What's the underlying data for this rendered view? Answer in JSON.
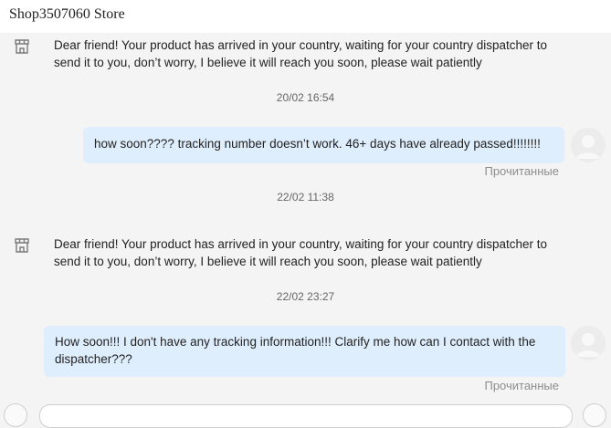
{
  "header": {
    "title": "Shop3507060 Store"
  },
  "messages": [
    {
      "sender": "shop",
      "text": "Dear friend! Your product has arrived in your country, waiting for your country dispatcher to send it to you, don’t worry, I believe it will reach you soon, please wait patiently"
    },
    {
      "timestamp": "20/02 16:54"
    },
    {
      "sender": "user",
      "text": "how soon???? tracking number doesn’t work. 46+ days have already passed!!!!!!!!",
      "status": "Прочитанные"
    },
    {
      "timestamp": "22/02 11:38"
    },
    {
      "sender": "shop",
      "text": "Dear friend! Your product has arrived in your country, waiting for your country dispatcher to send it to you, don’t worry, I believe it will reach you soon, please wait patiently"
    },
    {
      "timestamp": "22/02 23:27"
    },
    {
      "sender": "user",
      "text": "How soon!!! I don't have any tracking information!!! Clarify me how can I contact with the dispatcher???",
      "status": "Прочитанные"
    }
  ],
  "icons": {
    "shop": "store-icon",
    "avatar": "user-avatar-icon"
  },
  "colors": {
    "user_bubble": "#dfeefc",
    "background": "#f4f4f4",
    "status_text": "#8d8d8d"
  }
}
